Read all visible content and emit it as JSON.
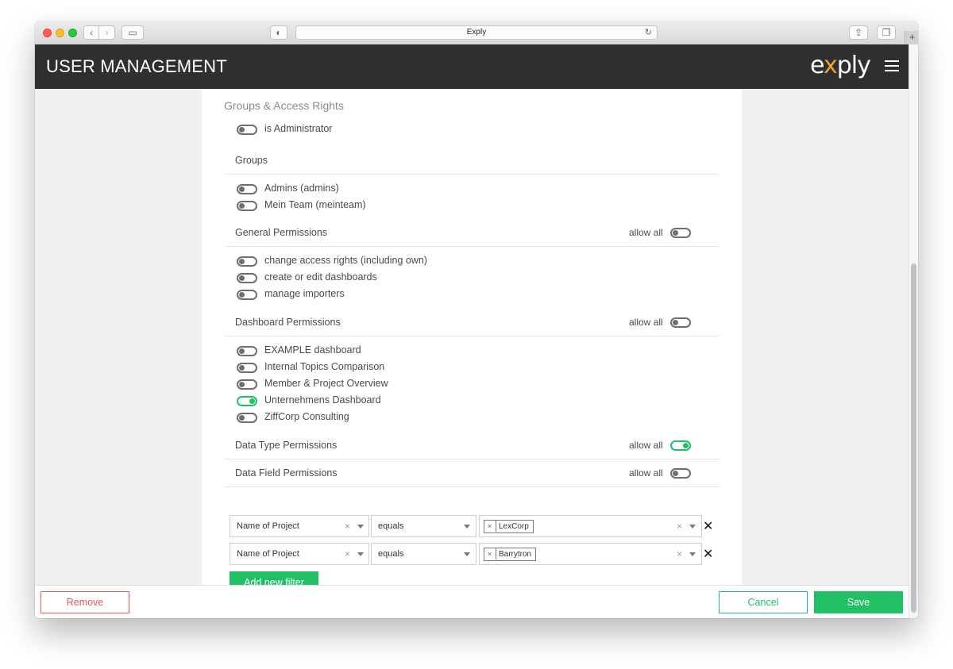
{
  "browser": {
    "address": "Exply",
    "back_glyph": "‹",
    "forward_glyph": "›",
    "reload_glyph": "↻",
    "privacy_glyph": "◐",
    "share_glyph": "⇪",
    "tabs_glyph": "❐",
    "new_tab_glyph": "+",
    "sidebar_glyph": "▭"
  },
  "header": {
    "title": "USER MANAGEMENT",
    "logo_a": "e",
    "logo_x": "x",
    "logo_b": "ply"
  },
  "access": {
    "section_title": "Groups & Access Rights",
    "is_admin": {
      "label": "is Administrator",
      "on": false
    }
  },
  "groups": {
    "title": "Groups",
    "items": [
      {
        "label": "Admins (admins)",
        "on": false
      },
      {
        "label": "Mein Team (meinteam)",
        "on": false
      }
    ]
  },
  "general": {
    "title": "General Permissions",
    "allow_all_label": "allow all",
    "allow_all_on": false,
    "items": [
      {
        "label": "change access rights (including own)",
        "on": false
      },
      {
        "label": "create or edit dashboards",
        "on": false
      },
      {
        "label": "manage importers",
        "on": false
      }
    ]
  },
  "dashboard": {
    "title": "Dashboard Permissions",
    "allow_all_label": "allow all",
    "allow_all_on": false,
    "items": [
      {
        "label": "EXAMPLE dashboard",
        "on": false
      },
      {
        "label": "Internal Topics Comparison",
        "on": false
      },
      {
        "label": "Member & Project Overview",
        "on": false
      },
      {
        "label": "Unternehmens Dashboard",
        "on": true
      },
      {
        "label": "ZiffCorp Consulting",
        "on": false
      }
    ]
  },
  "datatype": {
    "title": "Data Type Permissions",
    "allow_all_label": "allow all",
    "allow_all_on": true
  },
  "datafield": {
    "title": "Data Field Permissions",
    "allow_all_label": "allow all",
    "allow_all_on": false
  },
  "filters": [
    {
      "field": "Name of Project",
      "operator": "equals",
      "value": "LexCorp"
    },
    {
      "field": "Name of Project",
      "operator": "equals",
      "value": "Barrytron"
    }
  ],
  "filter_glyphs": {
    "clear": "×",
    "tag_remove": "×",
    "remove_row": "✕"
  },
  "add_filter_label": "Add new filter",
  "footer": {
    "remove_label": "Remove",
    "cancel_label": "Cancel",
    "save_label": "Save"
  },
  "colors": {
    "accent_green": "#22c064",
    "danger_red": "#e55a5a",
    "header_bg": "#2f2f2f",
    "logo_x": "#f0a32e"
  }
}
